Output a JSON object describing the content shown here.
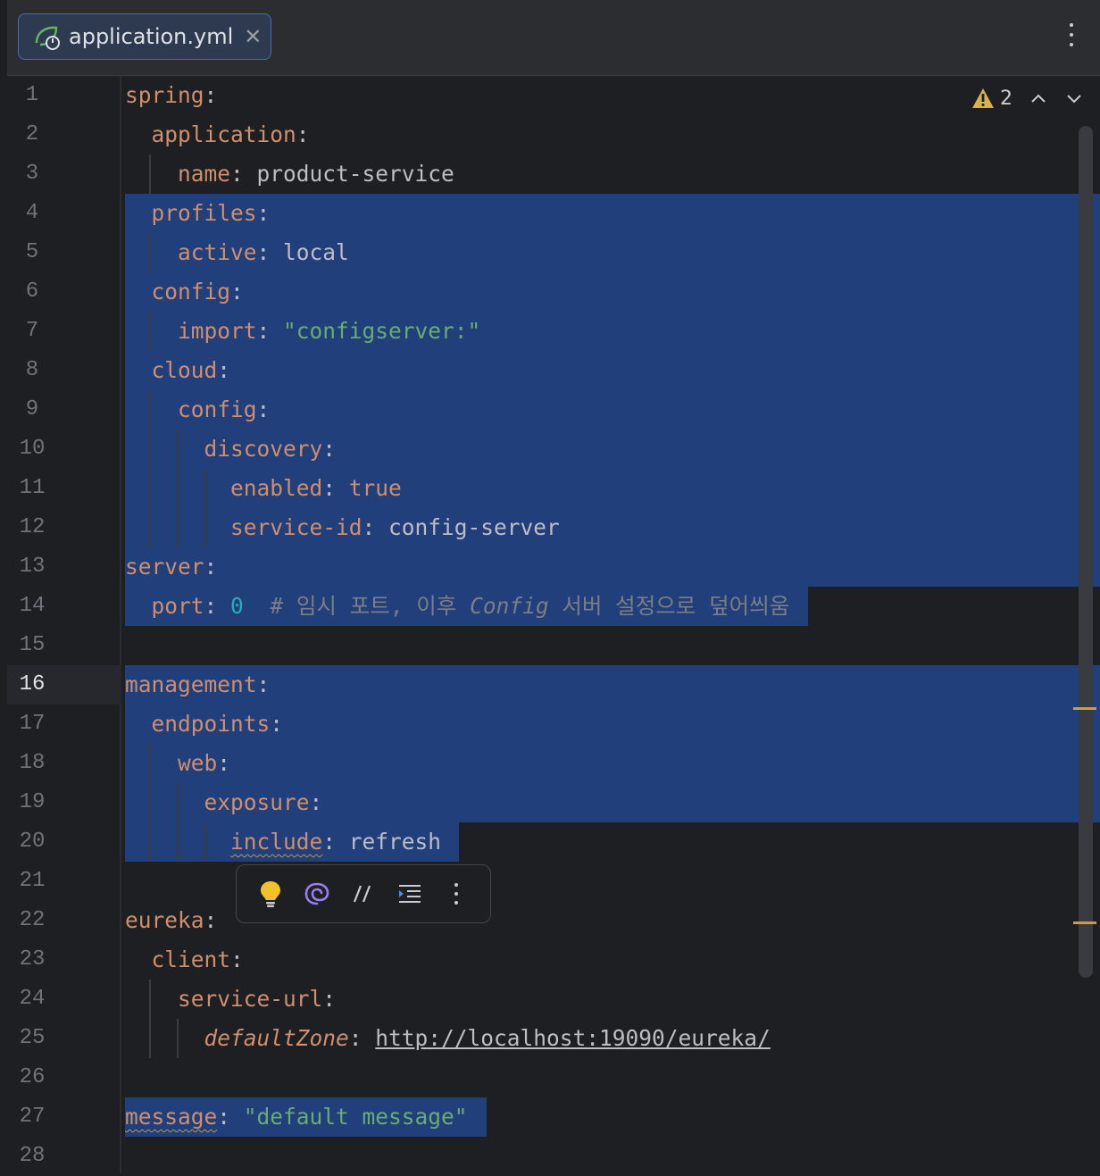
{
  "tab": {
    "filename": "application.yml",
    "close": "✕"
  },
  "inspection": {
    "warning_count": "2"
  },
  "editor": {
    "current_line": 16,
    "lines": [
      {
        "n": "1",
        "seg": [
          [
            "k",
            "spring"
          ],
          [
            "c",
            ":"
          ]
        ]
      },
      {
        "n": "2",
        "seg": [
          [
            "c",
            "  "
          ],
          [
            "k",
            "application"
          ],
          [
            "c",
            ":"
          ]
        ]
      },
      {
        "n": "3",
        "seg": [
          [
            "c",
            "    "
          ],
          [
            "k",
            "name"
          ],
          [
            "c",
            ": "
          ],
          [
            "v",
            "product-service"
          ]
        ]
      },
      {
        "n": "4",
        "seg": [
          [
            "c",
            "  "
          ],
          [
            "k",
            "profiles"
          ],
          [
            "c",
            ":"
          ]
        ]
      },
      {
        "n": "5",
        "seg": [
          [
            "c",
            "    "
          ],
          [
            "k",
            "active"
          ],
          [
            "c",
            ": "
          ],
          [
            "v",
            "local"
          ]
        ]
      },
      {
        "n": "6",
        "seg": [
          [
            "c",
            "  "
          ],
          [
            "k",
            "config"
          ],
          [
            "c",
            ":"
          ]
        ]
      },
      {
        "n": "7",
        "seg": [
          [
            "c",
            "    "
          ],
          [
            "k",
            "import"
          ],
          [
            "c",
            ": "
          ],
          [
            "s",
            "\"configserver:\""
          ]
        ]
      },
      {
        "n": "8",
        "seg": [
          [
            "c",
            "  "
          ],
          [
            "k",
            "cloud"
          ],
          [
            "c",
            ":"
          ]
        ]
      },
      {
        "n": "9",
        "seg": [
          [
            "c",
            "    "
          ],
          [
            "k",
            "config"
          ],
          [
            "c",
            ":"
          ]
        ]
      },
      {
        "n": "10",
        "seg": [
          [
            "c",
            "      "
          ],
          [
            "k",
            "discovery"
          ],
          [
            "c",
            ":"
          ]
        ]
      },
      {
        "n": "11",
        "seg": [
          [
            "c",
            "        "
          ],
          [
            "k",
            "enabled"
          ],
          [
            "c",
            ": "
          ],
          [
            "k",
            "true"
          ]
        ]
      },
      {
        "n": "12",
        "seg": [
          [
            "c",
            "        "
          ],
          [
            "k",
            "service-id"
          ],
          [
            "c",
            ": "
          ],
          [
            "v",
            "config-server"
          ]
        ]
      },
      {
        "n": "13",
        "seg": [
          [
            "k",
            "server"
          ],
          [
            "c",
            ":"
          ]
        ]
      },
      {
        "n": "14",
        "seg": [
          [
            "c",
            "  "
          ],
          [
            "k",
            "port"
          ],
          [
            "c",
            ": "
          ],
          [
            "n",
            "0"
          ],
          [
            "c",
            "  "
          ],
          [
            "cm",
            "# 임시 포트, 이후 "
          ],
          [
            "cmi",
            "Config"
          ],
          [
            "cm",
            " 서버 설정으로 덮어씌움"
          ]
        ]
      },
      {
        "n": "15",
        "seg": []
      },
      {
        "n": "16",
        "seg": [
          [
            "k",
            "management"
          ],
          [
            "c",
            ":"
          ]
        ]
      },
      {
        "n": "17",
        "seg": [
          [
            "c",
            "  "
          ],
          [
            "k",
            "endpoints"
          ],
          [
            "c",
            ":"
          ]
        ]
      },
      {
        "n": "18",
        "seg": [
          [
            "c",
            "    "
          ],
          [
            "k",
            "web"
          ],
          [
            "c",
            ":"
          ]
        ]
      },
      {
        "n": "19",
        "seg": [
          [
            "c",
            "      "
          ],
          [
            "k",
            "exposure"
          ],
          [
            "c",
            ":"
          ]
        ]
      },
      {
        "n": "20",
        "seg": [
          [
            "c",
            "        "
          ],
          [
            "kw",
            "include"
          ],
          [
            "c",
            ": "
          ],
          [
            "v",
            "refresh"
          ]
        ]
      },
      {
        "n": "21",
        "seg": []
      },
      {
        "n": "22",
        "seg": [
          [
            "k",
            "eureka"
          ],
          [
            "c",
            ":"
          ]
        ]
      },
      {
        "n": "23",
        "seg": [
          [
            "c",
            "  "
          ],
          [
            "k",
            "client"
          ],
          [
            "c",
            ":"
          ]
        ]
      },
      {
        "n": "24",
        "seg": [
          [
            "c",
            "    "
          ],
          [
            "k",
            "service-url"
          ],
          [
            "c",
            ":"
          ]
        ]
      },
      {
        "n": "25",
        "seg": [
          [
            "c",
            "      "
          ],
          [
            "ki",
            "defaultZone"
          ],
          [
            "c",
            ": "
          ],
          [
            "u",
            "http://localhost:19090/eureka/"
          ]
        ]
      },
      {
        "n": "26",
        "seg": []
      },
      {
        "n": "27",
        "seg": [
          [
            "kw",
            "message"
          ],
          [
            "c",
            ": "
          ],
          [
            "s",
            "\"default message\""
          ]
        ]
      },
      {
        "n": "28",
        "seg": []
      }
    ]
  },
  "floating_toolbar": {
    "items": [
      "lightbulb-icon",
      "ai-assistant-icon",
      "comment-icon",
      "indent-icon",
      "more-icon"
    ]
  },
  "colors": {
    "keyword": "#cf8e6d",
    "string": "#6aab73",
    "number": "#2aacb8",
    "selection": "#214283",
    "warning": "#c3a14a"
  }
}
